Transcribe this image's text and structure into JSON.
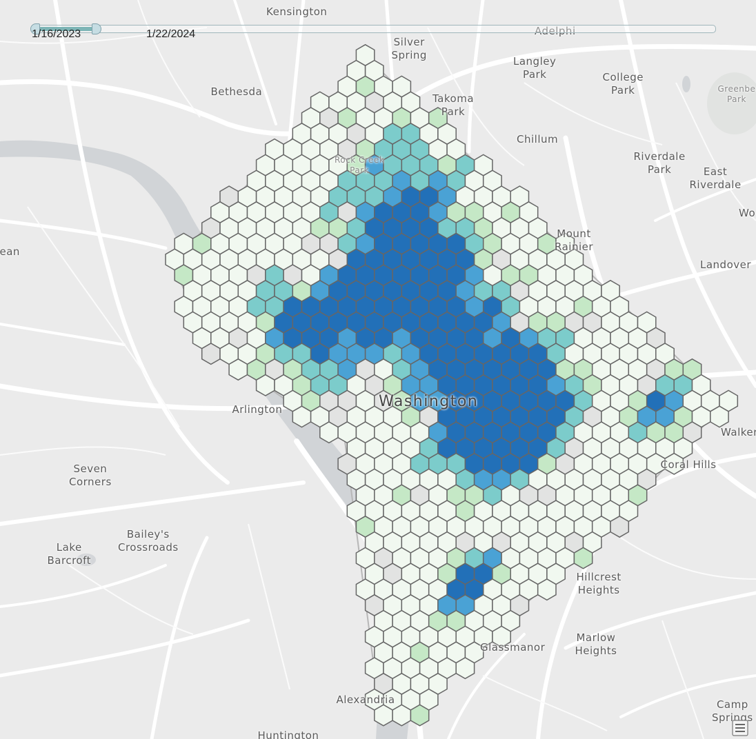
{
  "time_slider": {
    "start_label": "1/16/2023",
    "end_label": "1/22/2024",
    "position_fraction": 0.08
  },
  "places": [
    {
      "name": "Kensington"
    },
    {
      "name": "Silver\nSpring"
    },
    {
      "name": "Adelphi"
    },
    {
      "name": "Bethesda"
    },
    {
      "name": "Langley\nPark"
    },
    {
      "name": "College\nPark"
    },
    {
      "name": "Greenbe\nPark"
    },
    {
      "name": "Takoma\nPark"
    },
    {
      "name": "Chillum"
    },
    {
      "name": "Rock Creek\nPark"
    },
    {
      "name": "Riverdale\nPark"
    },
    {
      "name": "East\nRiverdale"
    },
    {
      "name": "Wo"
    },
    {
      "name": "ean"
    },
    {
      "name": "Mount\nRainier"
    },
    {
      "name": "Landover"
    },
    {
      "name": "Washington"
    },
    {
      "name": "Arlington"
    },
    {
      "name": "Walker"
    },
    {
      "name": "Coral Hills"
    },
    {
      "name": "Seven\nCorners"
    },
    {
      "name": "Bailey's\nCrossroads"
    },
    {
      "name": "Lake\nBarcroft"
    },
    {
      "name": "Hillcrest\nHeights"
    },
    {
      "name": "Marlow\nHeights"
    },
    {
      "name": "Glassmanor"
    },
    {
      "name": "Alexandria"
    },
    {
      "name": "Camp\nSprings"
    },
    {
      "name": "Huntington"
    }
  ],
  "legend_colors": [
    "#f1f8f0",
    "#c5e8c6",
    "#7ccccb",
    "#4aa2d5",
    "#2270b8"
  ],
  "empty_hex_color": "#e2e3e2",
  "icons": {
    "menu": "list-menu-icon"
  }
}
